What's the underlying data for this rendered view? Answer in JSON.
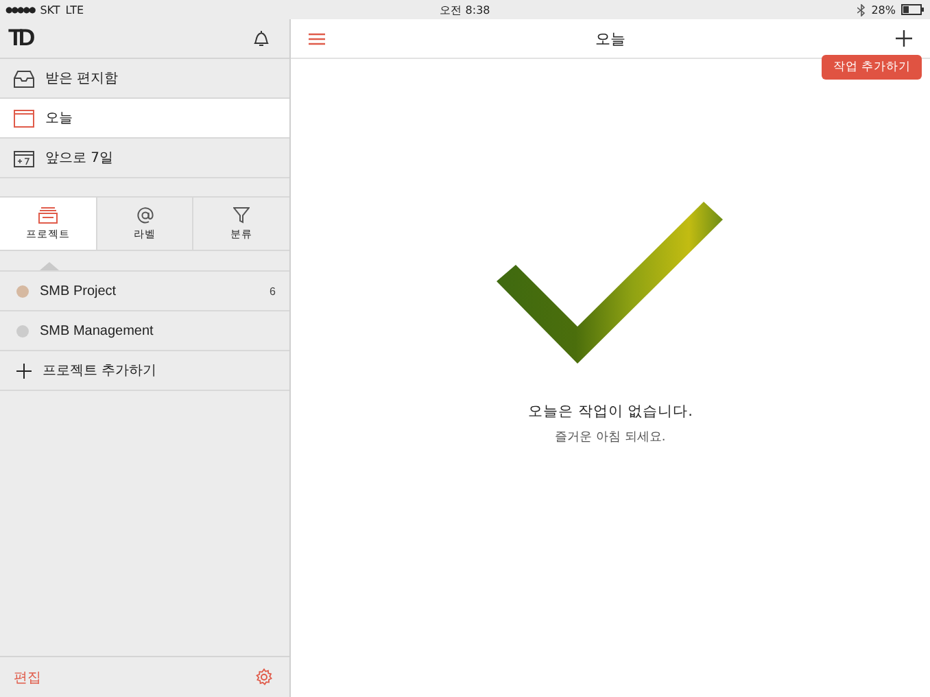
{
  "status_bar": {
    "signal": "●●●●●",
    "carrier": "SKT",
    "network": "LTE",
    "time": "오전 8:38",
    "battery": "28%"
  },
  "sidebar": {
    "logo": "TD",
    "nav": [
      {
        "kind": "inbox",
        "label": "받은 편지함",
        "selected": false
      },
      {
        "kind": "today",
        "label": "오늘",
        "selected": true
      },
      {
        "kind": "week",
        "label": "앞으로 7일",
        "selected": false
      }
    ],
    "tabs": [
      {
        "kind": "projects",
        "label": "프로젝트",
        "selected": true
      },
      {
        "kind": "labels",
        "label": "라벨",
        "selected": false
      },
      {
        "kind": "filters",
        "label": "분류",
        "selected": false
      }
    ],
    "projects": [
      {
        "name": "SMB Project",
        "color": "#d6b9a1",
        "count": "6"
      },
      {
        "name": "SMB Management",
        "color": "#cccccc"
      }
    ],
    "add_project": "프로젝트 추가하기",
    "edit": "편집"
  },
  "main": {
    "title": "오늘",
    "tooltip": "작업 추가하기",
    "empty_title": "오늘은 작업이 없습니다.",
    "empty_subtitle": "즐거운 아침 되세요."
  }
}
